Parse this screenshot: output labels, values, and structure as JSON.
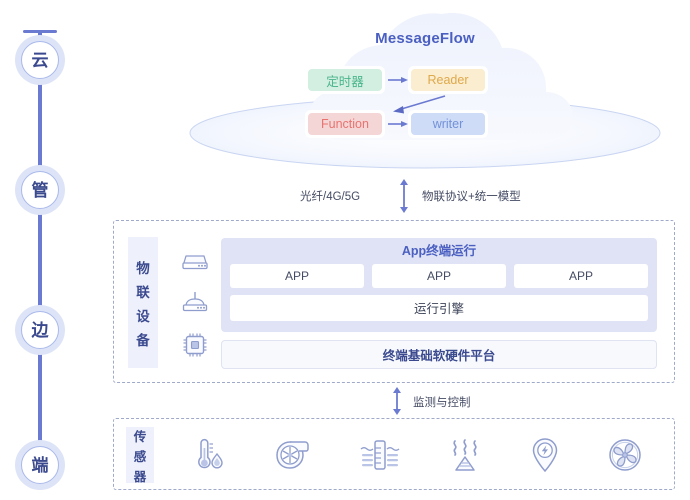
{
  "timeline": {
    "nodes": [
      {
        "label": "云",
        "name": "timeline-node-cloud"
      },
      {
        "label": "管",
        "name": "timeline-node-pipe"
      },
      {
        "label": "边",
        "name": "timeline-node-edge"
      },
      {
        "label": "端",
        "name": "timeline-node-terminal"
      }
    ]
  },
  "cloud": {
    "title": "MessageFlow",
    "nodes": {
      "timer": {
        "label": "定时器",
        "fill": "#d3efe1",
        "text": "#4bb58c"
      },
      "reader": {
        "label": "Reader",
        "fill": "#fbedcf",
        "text": "#dfa84b"
      },
      "function": {
        "label": "Function",
        "fill": "#f5d6d6",
        "text": "#e8736f"
      },
      "writer": {
        "label": "writer",
        "fill": "#cedcf8",
        "text": "#7391d6"
      }
    }
  },
  "link_cloud_to_device": {
    "left_label": "光纤/4G/5G",
    "right_label": "物联协议+统一模型"
  },
  "iot_device": {
    "side_label": "物联设备",
    "side_label_chars": [
      "物",
      "联",
      "设",
      "备"
    ],
    "icons": [
      "device-box-icon",
      "router-antenna-icon",
      "cpu-chip-icon"
    ],
    "app_panel": {
      "title": "App终端运行",
      "apps": [
        "APP",
        "APP",
        "APP"
      ],
      "engine": "运行引擎"
    },
    "platform": "终端基础软硬件平台"
  },
  "link_device_to_sensor": {
    "label": "监测与控制"
  },
  "sensors": {
    "side_label": "传感器",
    "side_label_chars": [
      "传",
      "感",
      "器"
    ],
    "icons": [
      "thermometer-humidity-icon",
      "turbine-blower-icon",
      "water-level-gauge-icon",
      "smoke-heat-icon",
      "location-power-pin-icon",
      "fan-icon"
    ]
  },
  "colors": {
    "accent": "#4a5fc1",
    "line": "#6b7ad1",
    "panel": "#dfe3f5",
    "side_strip": "#eef1fb",
    "dashed_border": "#9fa9c9"
  }
}
